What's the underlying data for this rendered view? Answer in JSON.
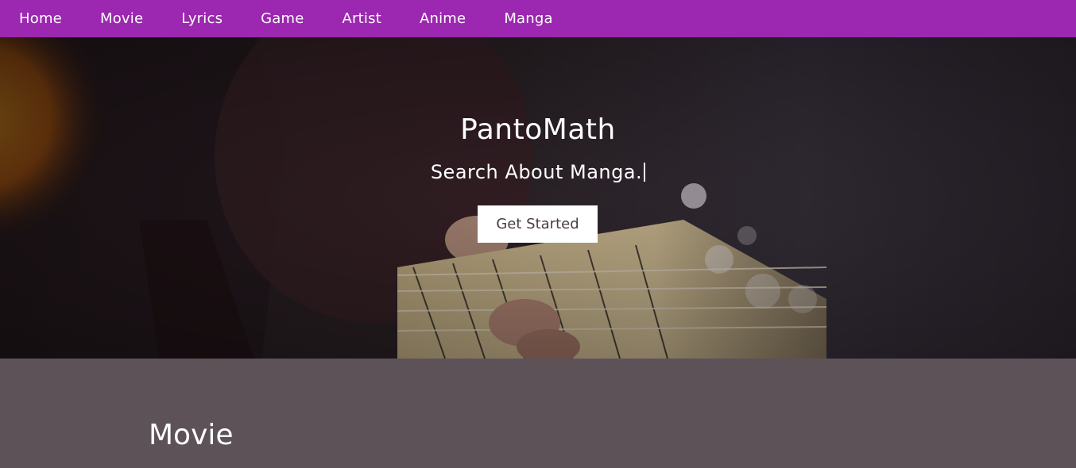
{
  "nav": {
    "items": [
      {
        "label": "Home"
      },
      {
        "label": "Movie"
      },
      {
        "label": "Lyrics"
      },
      {
        "label": "Game"
      },
      {
        "label": "Artist"
      },
      {
        "label": "Anime"
      },
      {
        "label": "Manga"
      }
    ],
    "color": "#9c27b0"
  },
  "hero": {
    "title": "PantoMath",
    "subtitle": "Search About Manga.",
    "button_label": "Get Started",
    "background_image": "guitar-photo"
  },
  "section": {
    "title": "Movie",
    "background": "#5e5259"
  }
}
